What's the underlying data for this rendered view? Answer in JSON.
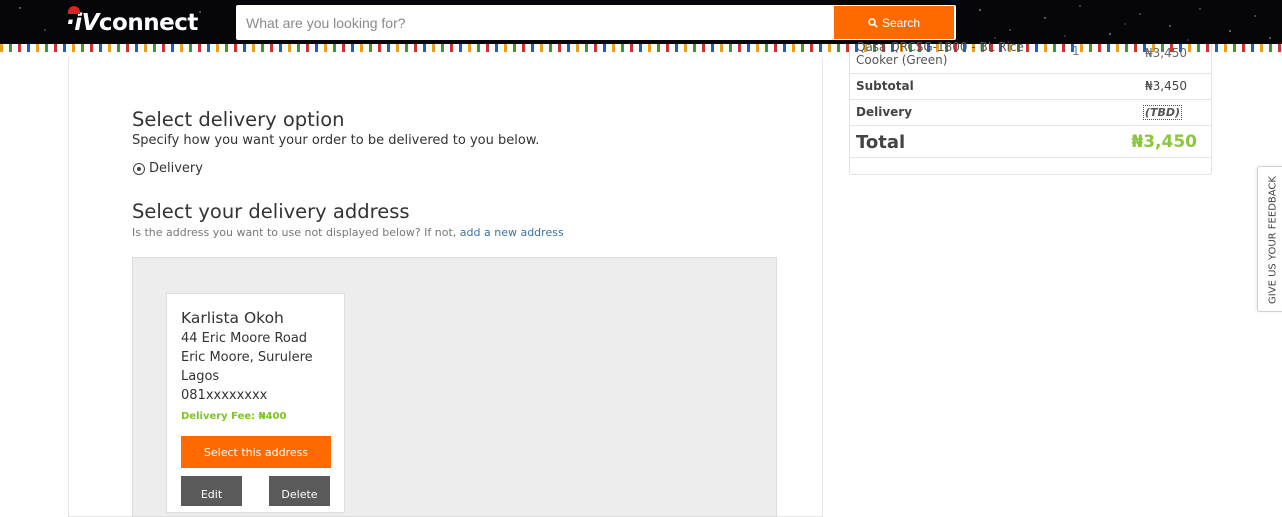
{
  "header": {
    "logo_text": "connect",
    "logo_mark": "·iV",
    "search_placeholder": "What are you looking for?",
    "search_button": "Search",
    "search_icon": "search-icon"
  },
  "delivery_option": {
    "title": "Select delivery option",
    "subtitle": "Specify how you want your order to be delivered to you below.",
    "option_label": "Delivery"
  },
  "delivery_address": {
    "title": "Select your delivery address",
    "hint": "Is the address you want to use not displayed below? If not,",
    "add_link": "add a new address",
    "card": {
      "name": "Karlista  Okoh",
      "line1": "44 Eric Moore Road",
      "line2": "Eric Moore, Surulere",
      "line3": "Lagos",
      "phone": "081xxxxxxxx",
      "fee": "Delivery Fee: ₦400",
      "select_label": "Select this address",
      "edit_label": "Edit",
      "delete_label": "Delete"
    }
  },
  "summary": {
    "item_name_top": "Qasa QRCSG-1800 - BL Rice",
    "item_name_bottom": "Cooker (Green)",
    "item_qty": "1",
    "item_price": "₦3,450",
    "subtotal_label": "Subtotal",
    "subtotal_value": "₦3,450",
    "delivery_label": "Delivery",
    "delivery_value": "(TBD)",
    "total_label": "Total",
    "total_value": "₦3,450"
  },
  "feedback_tab": "GIVE US YOUR FEEDBACK",
  "colors": {
    "accent": "#ff6a00",
    "price_green": "#8cc63f",
    "link": "#3a72a6"
  }
}
